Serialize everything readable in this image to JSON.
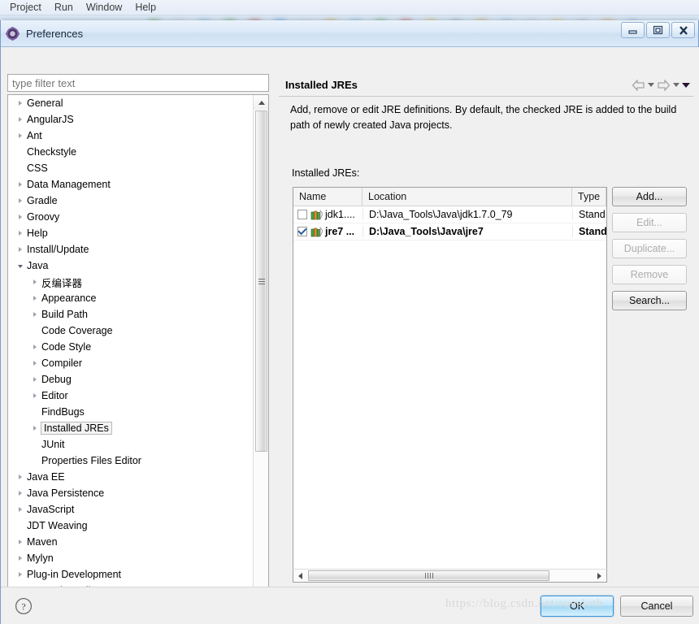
{
  "ide": {
    "menubar": [
      "Project",
      "Run",
      "Window",
      "Help"
    ]
  },
  "window": {
    "title": "Preferences",
    "icon": "gear-icon",
    "controls": {
      "minimize": "—",
      "maximize": "□",
      "close": "✕"
    }
  },
  "filter": {
    "placeholder": "type filter text",
    "value": ""
  },
  "tree": {
    "items": [
      {
        "label": "General",
        "indent": 0,
        "state": "closed"
      },
      {
        "label": "AngularJS",
        "indent": 0,
        "state": "closed"
      },
      {
        "label": "Ant",
        "indent": 0,
        "state": "closed"
      },
      {
        "label": "Checkstyle",
        "indent": 0,
        "state": "leaf"
      },
      {
        "label": "CSS",
        "indent": 0,
        "state": "leaf"
      },
      {
        "label": "Data Management",
        "indent": 0,
        "state": "closed"
      },
      {
        "label": "Gradle",
        "indent": 0,
        "state": "closed"
      },
      {
        "label": "Groovy",
        "indent": 0,
        "state": "closed"
      },
      {
        "label": "Help",
        "indent": 0,
        "state": "closed"
      },
      {
        "label": "Install/Update",
        "indent": 0,
        "state": "closed"
      },
      {
        "label": "Java",
        "indent": 0,
        "state": "open"
      },
      {
        "label": "反编译器",
        "indent": 1,
        "state": "closed"
      },
      {
        "label": "Appearance",
        "indent": 1,
        "state": "closed"
      },
      {
        "label": "Build Path",
        "indent": 1,
        "state": "closed"
      },
      {
        "label": "Code Coverage",
        "indent": 1,
        "state": "leaf"
      },
      {
        "label": "Code Style",
        "indent": 1,
        "state": "closed"
      },
      {
        "label": "Compiler",
        "indent": 1,
        "state": "closed"
      },
      {
        "label": "Debug",
        "indent": 1,
        "state": "closed"
      },
      {
        "label": "Editor",
        "indent": 1,
        "state": "closed"
      },
      {
        "label": "FindBugs",
        "indent": 1,
        "state": "leaf"
      },
      {
        "label": "Installed JREs",
        "indent": 1,
        "state": "closed",
        "selected": true
      },
      {
        "label": "JUnit",
        "indent": 1,
        "state": "leaf"
      },
      {
        "label": "Properties Files Editor",
        "indent": 1,
        "state": "leaf"
      },
      {
        "label": "Java EE",
        "indent": 0,
        "state": "closed"
      },
      {
        "label": "Java Persistence",
        "indent": 0,
        "state": "closed"
      },
      {
        "label": "JavaScript",
        "indent": 0,
        "state": "closed"
      },
      {
        "label": "JDT Weaving",
        "indent": 0,
        "state": "leaf"
      },
      {
        "label": "Maven",
        "indent": 0,
        "state": "closed"
      },
      {
        "label": "Mylyn",
        "indent": 0,
        "state": "closed"
      },
      {
        "label": "Plug-in Development",
        "indent": 0,
        "state": "closed"
      },
      {
        "label": "Properties Editor",
        "indent": 0,
        "state": "closed"
      }
    ]
  },
  "page": {
    "title": "Installed JREs",
    "description": "Add, remove or edit JRE definitions. By default, the checked JRE is added to the build path of newly created Java projects.",
    "list_label": "Installed JREs:",
    "nav": {
      "back": "back-arrow",
      "back_menu": "back-dropdown",
      "forward": "forward-arrow",
      "forward_menu": "forward-dropdown",
      "view_menu": "view-menu-caret"
    }
  },
  "table": {
    "columns": [
      "Name",
      "Location",
      "Type"
    ],
    "rows": [
      {
        "checked": false,
        "name": "jdk1....",
        "location": "D:\\Java_Tools\\Java\\jdk1.7.0_79",
        "type": "Stand",
        "bold": false
      },
      {
        "checked": true,
        "name": "jre7 ...",
        "location": "D:\\Java_Tools\\Java\\jre7",
        "type": "Stand",
        "bold": true
      }
    ]
  },
  "side_buttons": [
    {
      "label": "Add...",
      "enabled": true
    },
    {
      "label": "Edit...",
      "enabled": false
    },
    {
      "label": "Duplicate...",
      "enabled": false
    },
    {
      "label": "Remove",
      "enabled": false
    },
    {
      "label": "Search...",
      "enabled": true
    }
  ],
  "footer": {
    "help": "?",
    "ok_label": "OK",
    "cancel_label": "Cancel"
  },
  "watermark": "https://blog.csdn.net/sunsloth",
  "colors": {
    "dialog_bg": "#f0f0f0",
    "title_gradient_top": "#e9f2fb",
    "default_button_accent": "#9fd8f6",
    "selection_border": "#b9b9b9"
  }
}
